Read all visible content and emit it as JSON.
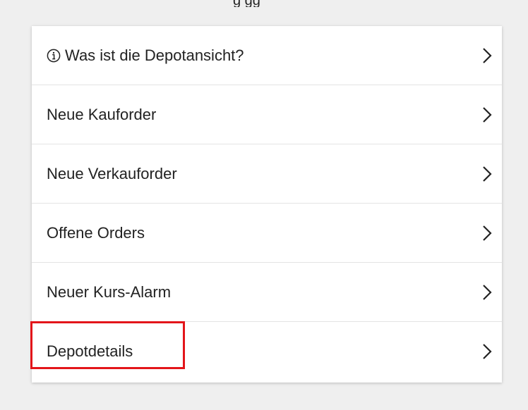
{
  "clipped_top_text": "g gg",
  "menu": {
    "items": [
      {
        "label": "Was ist die Depotansicht?",
        "icon": "info-icon",
        "trailing_icon": "chevron-right-icon"
      },
      {
        "label": "Neue Kauforder",
        "trailing_icon": "chevron-right-icon"
      },
      {
        "label": "Neue Verkauforder",
        "trailing_icon": "chevron-right-icon"
      },
      {
        "label": "Offene Orders",
        "trailing_icon": "chevron-right-icon"
      },
      {
        "label": "Neuer Kurs-Alarm",
        "trailing_icon": "chevron-right-icon"
      },
      {
        "label": "Depotdetails",
        "trailing_icon": "chevron-right-icon",
        "highlighted": true
      }
    ]
  },
  "colors": {
    "background": "#efefef",
    "card": "#ffffff",
    "text": "#222222",
    "divider": "#e4e4e4",
    "highlight": "#e3151a"
  }
}
